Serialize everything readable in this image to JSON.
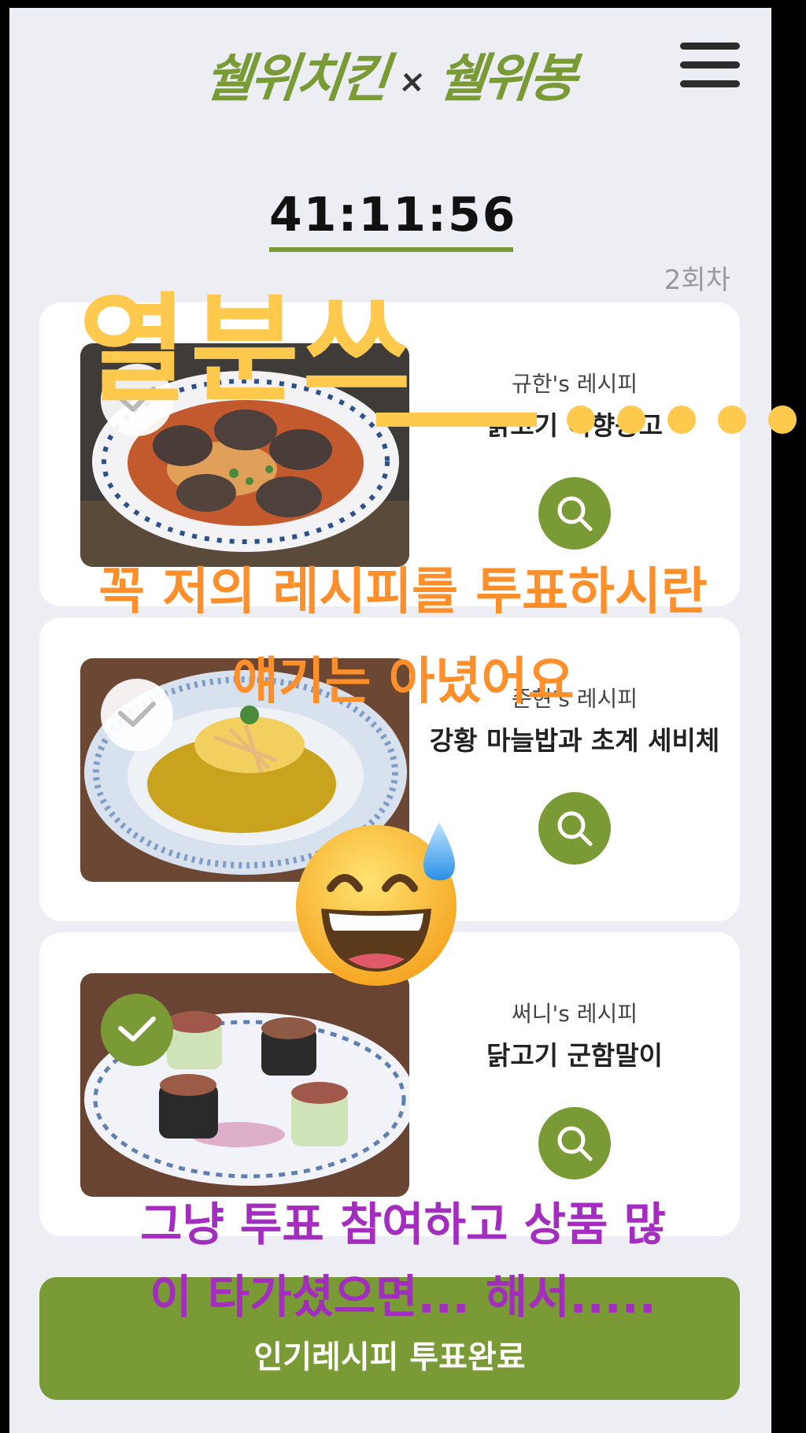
{
  "header": {
    "brand_left": "쉘위치킨",
    "brand_separator": "×",
    "brand_right": "쉘위봉"
  },
  "timer": "41:11:56",
  "round_label": "2회차",
  "recipes": [
    {
      "author": "규한's 레시피",
      "dish": "닭고기 어향동고",
      "selected": false
    },
    {
      "author": "준현's 레시피",
      "dish": "강황 마늘밥과 초계 세비체",
      "selected": false
    },
    {
      "author": "써니's 레시피",
      "dish": "닭고기 군함말이",
      "selected": true
    }
  ],
  "submit_label": "인기레시피 투표완료",
  "overlay": {
    "big": "열분쓰",
    "line1": "꼭 저의 레시피를 투표하시란",
    "line2": "얘기는 아녔어요",
    "line3": "그냥 투표 참여하고 상품 많",
    "line4": "이 타가셨으면... 해서....."
  },
  "colors": {
    "accent": "#7a9a35",
    "background": "#eceef4",
    "overlay_yellow": "#ffc94d",
    "overlay_orange": "#ff8f2a",
    "overlay_purple": "#a22dbf"
  },
  "icons": [
    "menu-icon",
    "check-icon",
    "search-icon",
    "sweat-smile-emoji"
  ]
}
